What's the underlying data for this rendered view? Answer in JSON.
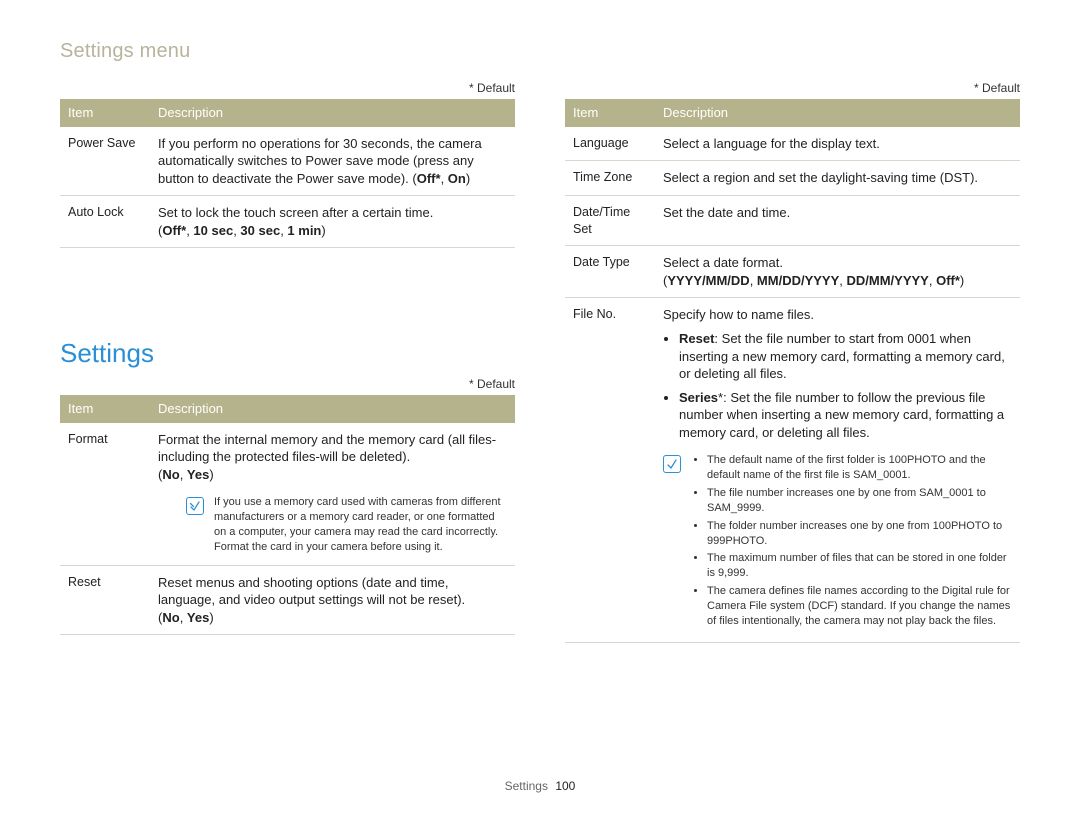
{
  "page": {
    "section_title": "Settings menu",
    "footer_label": "Settings",
    "footer_page": "100",
    "default_marker": "* Default",
    "heading_settings": "Settings"
  },
  "table_headers": {
    "item": "Item",
    "description": "Description"
  },
  "tableA": {
    "rows": [
      {
        "item": "Power Save",
        "desc_intro": "If you perform no operations for 30 seconds, the camera automatically switches to Power save mode (press any button to deactivate the Power save mode).",
        "options": [
          "Off*",
          "On"
        ]
      },
      {
        "item": "Auto Lock",
        "desc_intro": "Set to lock the touch screen after a certain time.",
        "options": [
          "Off*",
          "10 sec",
          "30 sec",
          "1 min"
        ]
      }
    ]
  },
  "tableB": {
    "rows": [
      {
        "item": "Format",
        "desc_intro": "Format the internal memory and the memory card (all files-including the protected files-will be deleted).",
        "options": [
          "No",
          "Yes"
        ],
        "note": "If you use a memory card used with cameras from different manufacturers or a memory card reader, or one formatted on a computer, your camera may read the card incorrectly. Format the card in your camera before using it."
      },
      {
        "item": "Reset",
        "desc_intro": "Reset menus and shooting options (date and time, language, and video output settings will not be reset).",
        "options": [
          "No",
          "Yes"
        ]
      }
    ]
  },
  "tableC": {
    "rows": [
      {
        "item": "Language",
        "desc_intro": "Select a language for the display text."
      },
      {
        "item": "Time Zone",
        "desc_intro": "Select a region and set the daylight-saving time (DST)."
      },
      {
        "item": "Date/Time Set",
        "desc_intro": "Set the date and time."
      },
      {
        "item": "Date Type",
        "desc_intro": "Select a date format.",
        "options": [
          "YYYY/MM/DD",
          "MM/DD/YYYY",
          "DD/MM/YYYY",
          "Off*"
        ]
      },
      {
        "item": "File No.",
        "desc_intro": "Specify how to name files.",
        "subitems": [
          {
            "label": "Reset",
            "text": ": Set the file number to start from 0001 when inserting a new memory card, formatting a memory card, or deleting all files."
          },
          {
            "label": "Series",
            "star": "*",
            "text": ": Set the file number to follow the previous file number when inserting a new memory card, formatting a memory card, or deleting all files."
          }
        ],
        "notes": [
          "The default name of the first folder is 100PHOTO and the default name of the first file is SAM_0001.",
          "The file number increases one by one from SAM_0001 to SAM_9999.",
          "The folder number increases one by one from 100PHOTO to 999PHOTO.",
          "The maximum number of files that can be stored in one folder is 9,999.",
          "The camera defines file names according to the Digital rule for Camera File system (DCF) standard. If you change the names of files intentionally, the camera may not play back the files."
        ]
      }
    ]
  }
}
